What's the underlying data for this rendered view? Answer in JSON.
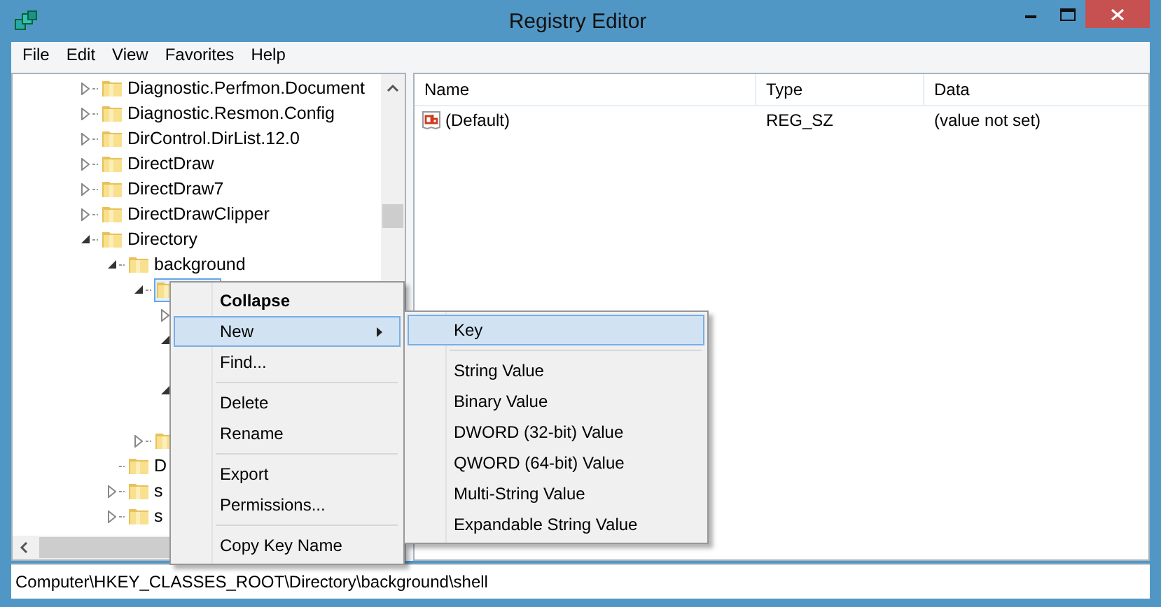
{
  "window": {
    "title": "Registry Editor"
  },
  "menu_bar": [
    "File",
    "Edit",
    "View",
    "Favorites",
    "Help"
  ],
  "tree": [
    {
      "label": "Diagnostic.Perfmon.Document",
      "expanded": false
    },
    {
      "label": "Diagnostic.Resmon.Config",
      "expanded": false
    },
    {
      "label": "DirControl.DirList.12.0",
      "expanded": false
    },
    {
      "label": "DirectDraw",
      "expanded": false
    },
    {
      "label": "DirectDraw7",
      "expanded": false
    },
    {
      "label": "DirectDrawClipper",
      "expanded": false
    },
    {
      "label": "Directory",
      "expanded": true,
      "children": [
        {
          "label": "background",
          "expanded": true,
          "children": [
            {
              "selected": true,
              "expanded": true,
              "children": [
                {
                  "expanded": false
                },
                {
                  "expanded": true
                },
                {
                  "expanded": true
                }
              ]
            },
            {
              "expanded": false
            }
          ]
        },
        {
          "label": "D"
        },
        {
          "label": "s",
          "expanded": false
        },
        {
          "label": "s",
          "expanded": false
        }
      ]
    }
  ],
  "values_table": {
    "columns": [
      "Name",
      "Type",
      "Data"
    ],
    "rows": [
      {
        "name": "(Default)",
        "type": "REG_SZ",
        "data": "(value not set)"
      }
    ]
  },
  "context_menu": [
    {
      "kind": "item",
      "label": "Collapse",
      "bold": true,
      "selected": false
    },
    {
      "kind": "item",
      "label": "New",
      "submenu": true,
      "selected": true
    },
    {
      "kind": "item",
      "label": "Find...",
      "selected": false
    },
    {
      "kind": "separator"
    },
    {
      "kind": "item",
      "label": "Delete",
      "selected": false
    },
    {
      "kind": "item",
      "label": "Rename",
      "selected": false
    },
    {
      "kind": "separator"
    },
    {
      "kind": "item",
      "label": "Export",
      "selected": false
    },
    {
      "kind": "item",
      "label": "Permissions...",
      "selected": false
    },
    {
      "kind": "separator"
    },
    {
      "kind": "item",
      "label": "Copy Key Name",
      "selected": false
    }
  ],
  "submenu": [
    {
      "kind": "item",
      "label": "Key",
      "selected": true
    },
    {
      "kind": "separator"
    },
    {
      "kind": "item",
      "label": "String Value",
      "selected": false
    },
    {
      "kind": "item",
      "label": "Binary Value",
      "selected": false
    },
    {
      "kind": "item",
      "label": "DWORD (32-bit) Value",
      "selected": false
    },
    {
      "kind": "item",
      "label": "QWORD (64-bit) Value",
      "selected": false
    },
    {
      "kind": "item",
      "label": "Multi-String Value",
      "selected": false
    },
    {
      "kind": "item",
      "label": "Expandable String Value",
      "selected": false
    }
  ],
  "status_bar": "Computer\\HKEY_CLASSES_ROOT\\Directory\\background\\shell"
}
